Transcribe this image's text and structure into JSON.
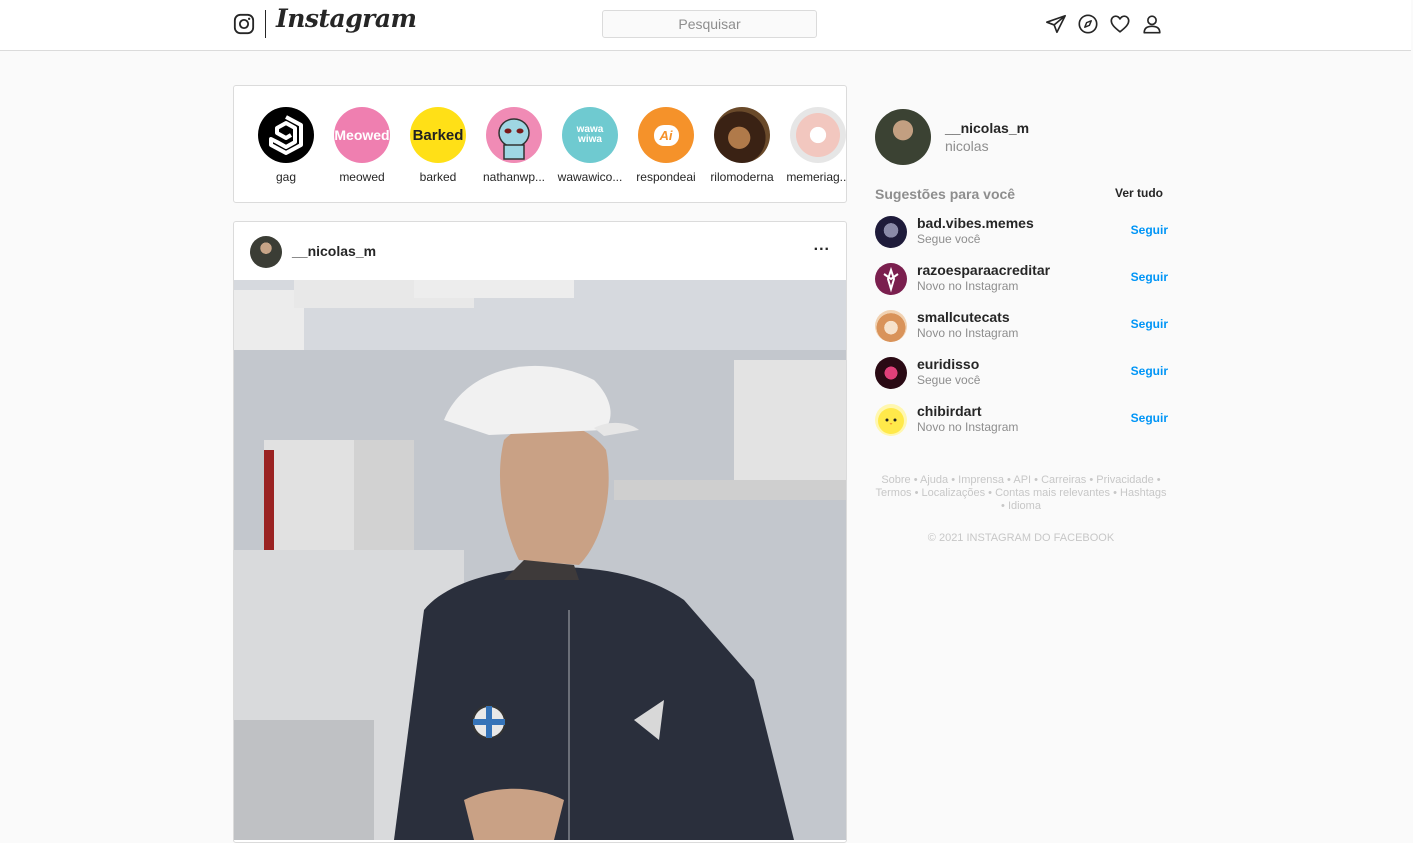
{
  "header": {
    "brand": "Instagram",
    "search_placeholder": "Pesquisar",
    "icons": [
      "instagram-glyph-icon",
      "direct-icon",
      "explore-icon",
      "activity-heart-icon",
      "profile-icon"
    ]
  },
  "stories": [
    {
      "name": "gag",
      "icon": "9gag-logo"
    },
    {
      "name": "meowed",
      "icon": "meowed-logo",
      "text": "Meowed"
    },
    {
      "name": "barked",
      "icon": "barked-logo",
      "text": "Barked"
    },
    {
      "name": "nathanwp...",
      "icon": "alien-avatar"
    },
    {
      "name": "wawawico...",
      "icon": "wawa-logo",
      "text": "wawa wiwa"
    },
    {
      "name": "respondeai",
      "icon": "respondeai-logo",
      "text": "Ai"
    },
    {
      "name": "rilomoderna",
      "icon": "rilomoderna-avatar"
    },
    {
      "name": "memeriag...",
      "icon": "memeria-avatar"
    }
  ],
  "post": {
    "username": "__nicolas_m",
    "more_label": "..."
  },
  "sidebar": {
    "me": {
      "username": "__nicolas_m",
      "name": "nicolas"
    },
    "suggestions_title": "Sugestões para você",
    "see_all": "Ver tudo",
    "suggestions": [
      {
        "username": "bad.vibes.memes",
        "subtitle": "Segue você",
        "action": "Seguir"
      },
      {
        "username": "razoesparaacreditar",
        "subtitle": "Novo no Instagram",
        "action": "Seguir"
      },
      {
        "username": "smallcutecats",
        "subtitle": "Novo no Instagram",
        "action": "Seguir"
      },
      {
        "username": "euridisso",
        "subtitle": "Segue você",
        "action": "Seguir"
      },
      {
        "username": "chibirdart",
        "subtitle": "Novo no Instagram",
        "action": "Seguir"
      }
    ],
    "footer_links": [
      "Sobre",
      "Ajuda",
      "Imprensa",
      "API",
      "Carreiras",
      "Privacidade",
      "Termos",
      "Localizações",
      "Contas mais relevantes",
      "Hashtags",
      "Idioma"
    ],
    "copyright": "© 2021 INSTAGRAM DO FACEBOOK"
  },
  "colors": {
    "accent": "#0095f6",
    "border": "#dbdbdb",
    "background": "#fafafa",
    "text": "#262626",
    "muted": "#8e8e8e"
  }
}
